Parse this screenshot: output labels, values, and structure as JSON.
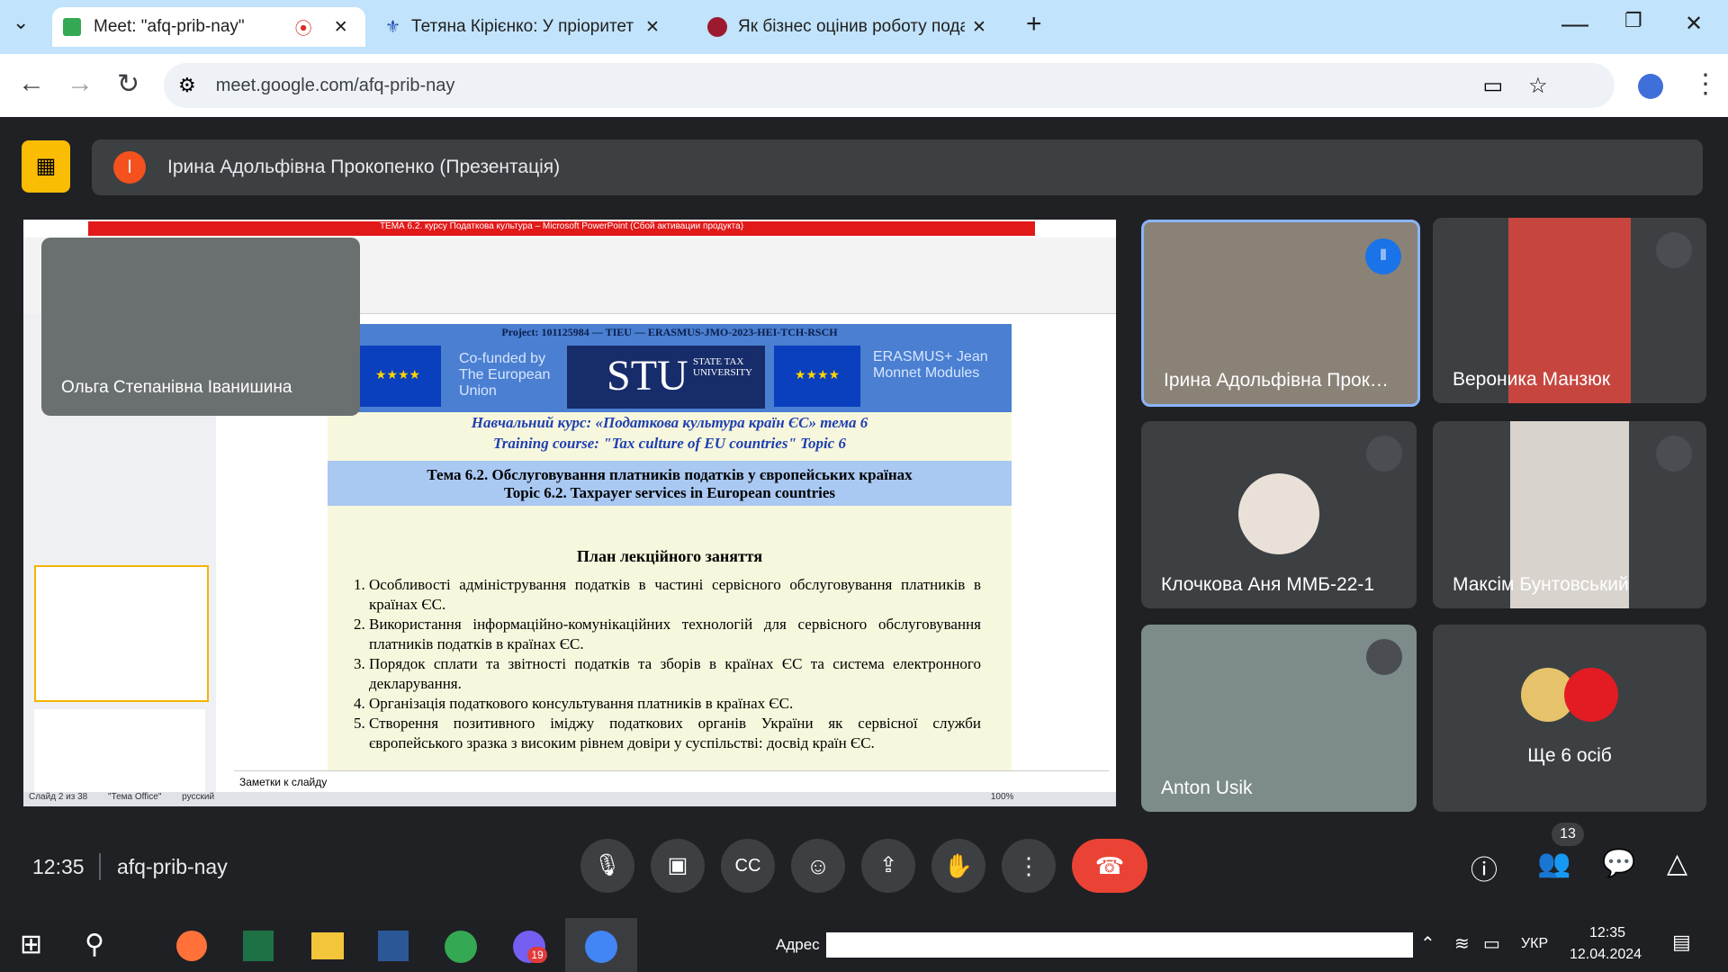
{
  "browser": {
    "tabs": [
      {
        "label": "Meet: \"afq-prib-nay\""
      },
      {
        "label": "Тетяна Кірієнко: У пріоритеті –"
      },
      {
        "label": "Як бізнес оцінив роботу подат"
      }
    ],
    "url": "meet.google.com/afq-prib-nay"
  },
  "meet": {
    "presenter_initial": "I",
    "presenter_label": "Ірина Адольфівна Прокопенко (Презентація)",
    "overlay_name": "Ольга Степанівна Іванишина",
    "participants": [
      {
        "name": "Ірина Адольфівна Прок…"
      },
      {
        "name": "Вероника Манзюк"
      },
      {
        "name": "Клочкова Аня ММБ-22-1"
      },
      {
        "name": "Максім Бунтовський"
      },
      {
        "name": "Anton Usik"
      },
      {
        "name": "Ще 6 осіб"
      }
    ],
    "time": "12:35",
    "code": "afq-prib-nay",
    "people_count": "13"
  },
  "slide": {
    "window_title": "ТЕМА 6.2. курсу Податкова культура – Microsoft PowerPoint (Сбой активации продукта)",
    "project": "Project: 101125984 — TIEU — ERASMUS-JMO-2023-HEI-TCH-RSCH",
    "cofunded": "Co-funded by The European Union",
    "stu": "STU",
    "stu_sub": "STATE TAX UNIVERSITY",
    "erasmus": "ERASMUS+ Jean Monnet Modules",
    "course_ua": "Навчальний курс: «Податкова культура країн ЄС» тема 6",
    "course_en": "Training course: \"Tax culture of EU countries\" Topic 6",
    "topic_ua": "Тема 6.2. Обслуговування платників податків у європейських країнах",
    "topic_en": "Topic 6.2. Taxpayer services in European countries",
    "plan": "План лекційного заняття",
    "items": [
      "Особливості адміністрування податків в частині сервісного обслуговування платників в країнах ЄС.",
      "Використання інформаційно-комунікаційних технологій для сервісного обслуговування платників податків в країнах ЄС.",
      "Порядок сплати та звітності податків та зборів в країнах ЄС та система електронного декларування.",
      "Організація податкового консультування платників в країнах ЄС.",
      "Створення позитивного іміджу податкових органів України як сервісної служби європейського зразка з високим рівнем довіри у суспільстві: досвід країн ЄС."
    ],
    "notes": "Заметки к слайду",
    "status": "Слайд 2 из 38",
    "theme": "\"Тема Office\"",
    "lang": "русский",
    "zoom": "100%"
  },
  "taskbar": {
    "address_label": "Адрес",
    "lang": "УКР",
    "time": "12:35",
    "date": "12.04.2024",
    "viber": "19"
  }
}
